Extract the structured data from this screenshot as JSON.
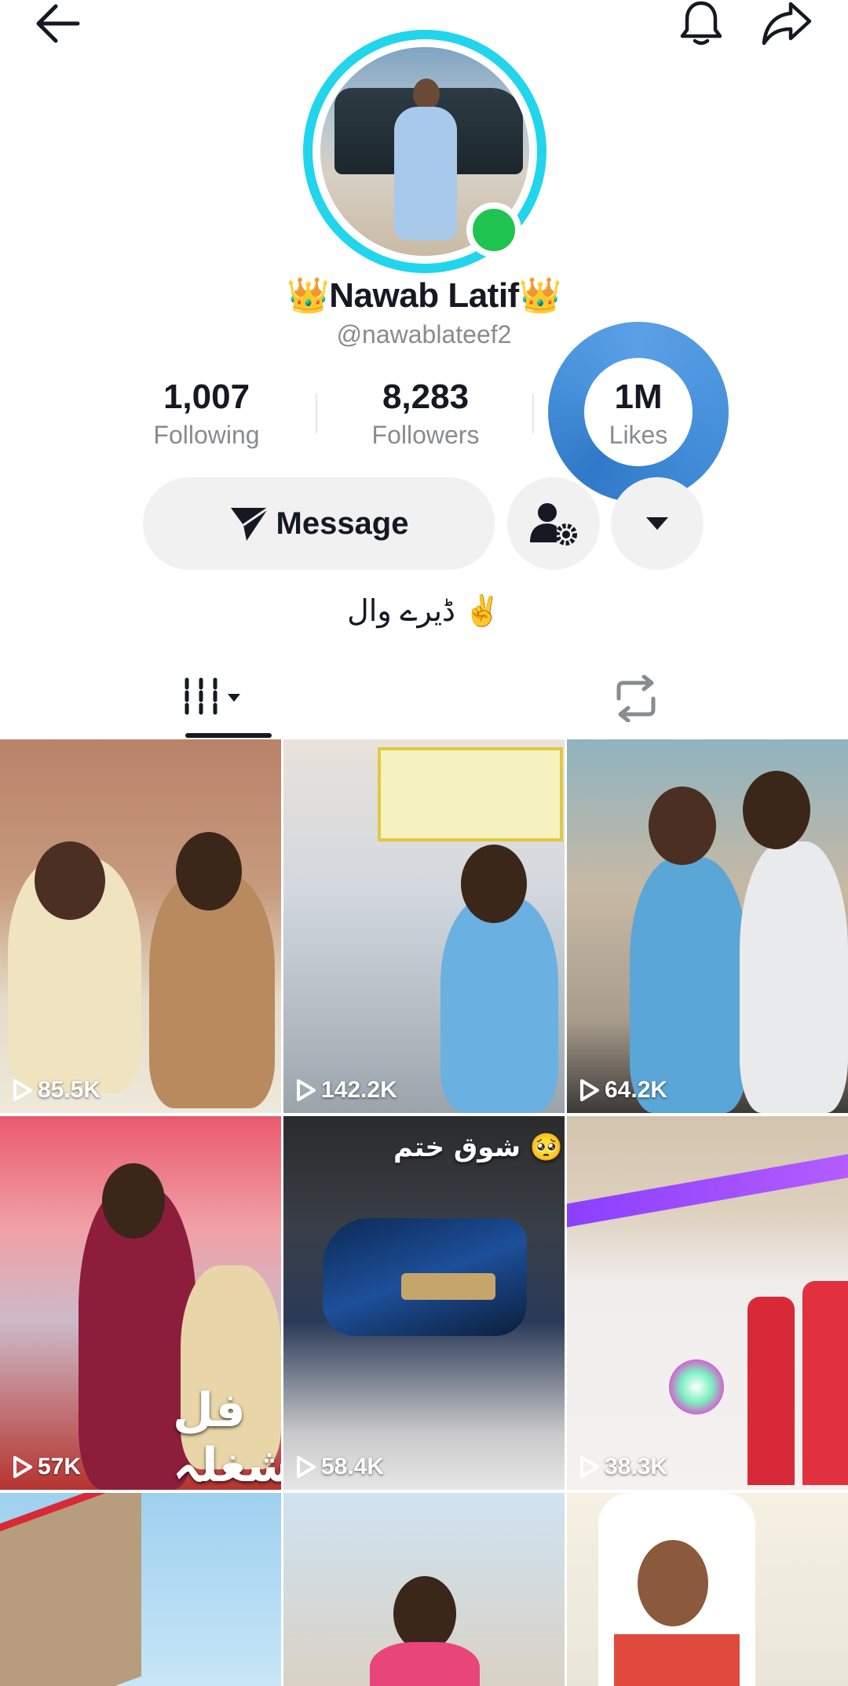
{
  "profile": {
    "name": "👑Nawab Latif👑",
    "handle": "@nawablateef2",
    "bio": "ڈیرے وال ✌️",
    "stats": {
      "following_count": "1,007",
      "following_label": "Following",
      "followers_count": "8,283",
      "followers_label": "Followers",
      "likes_count": "1M",
      "likes_label": "Likes"
    },
    "online": true
  },
  "actions": {
    "message_label": "Message"
  },
  "colors": {
    "avatar_ring": "#20d5ec",
    "online_dot": "#1fc350",
    "likes_highlight": "#4a94dc",
    "button_bg": "#f1f1f2"
  },
  "icons": {
    "back": "arrow-left-icon",
    "bell": "bell-icon",
    "share": "share-arrow-icon",
    "message": "paper-plane-icon",
    "friend_settings": "user-gear-icon",
    "more": "caret-down-icon",
    "videos_tab": "grid-columns-icon",
    "reposts_tab": "repost-icon",
    "play": "play-icon"
  },
  "videos": [
    {
      "views": "85.5K"
    },
    {
      "views": "142.2K"
    },
    {
      "views": "64.2K"
    },
    {
      "views": "57K",
      "overlay_text": "فل شغلہ"
    },
    {
      "views": "58.4K",
      "overlay_text": "شوق ختم 🥺"
    },
    {
      "views": "38.3K"
    },
    {
      "views": ""
    },
    {
      "views": ""
    },
    {
      "views": ""
    }
  ]
}
